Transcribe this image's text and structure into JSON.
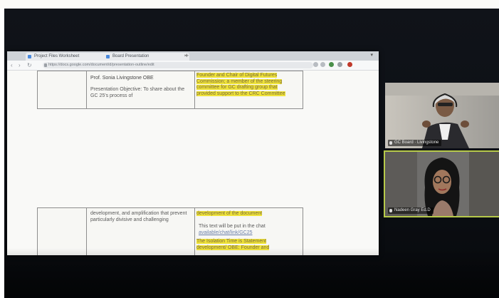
{
  "caption": "",
  "browser": {
    "tabs": [
      {
        "label": "Project Files Worksheet"
      },
      {
        "label": "Board Presentation"
      }
    ],
    "url": "https://docs.google.com/document/d/presentation-outline/edit"
  },
  "document": {
    "table_top": {
      "presenter": "Prof. Sonia Livingstone OBE",
      "objective": "Presentation Objective: To share about the GC 25's process of",
      "highlighted": "Founder and Chair of Digital Futures Commission; a member of the steering committee for GC drafting group that provided support to the CRC Committee"
    },
    "table_bottom": {
      "middle": "development, and amplification that prevent particularly divisive and challenging",
      "highlight_top": "development of the document",
      "plain": "This text will be put in the chat",
      "link": "available/chat/link/GC25",
      "highlight_bottom": "The Isolation Time is Statement development/ OBE: Founder and"
    }
  },
  "participants": [
    {
      "name": "GC Board · Livingstone",
      "active": false
    },
    {
      "name": "Nadeen Gray Ed.D",
      "active": true
    }
  ],
  "colors": {
    "highlight": "#efe33a",
    "active_border": "#b6c94a",
    "screen_bg": "#0c0f14"
  }
}
